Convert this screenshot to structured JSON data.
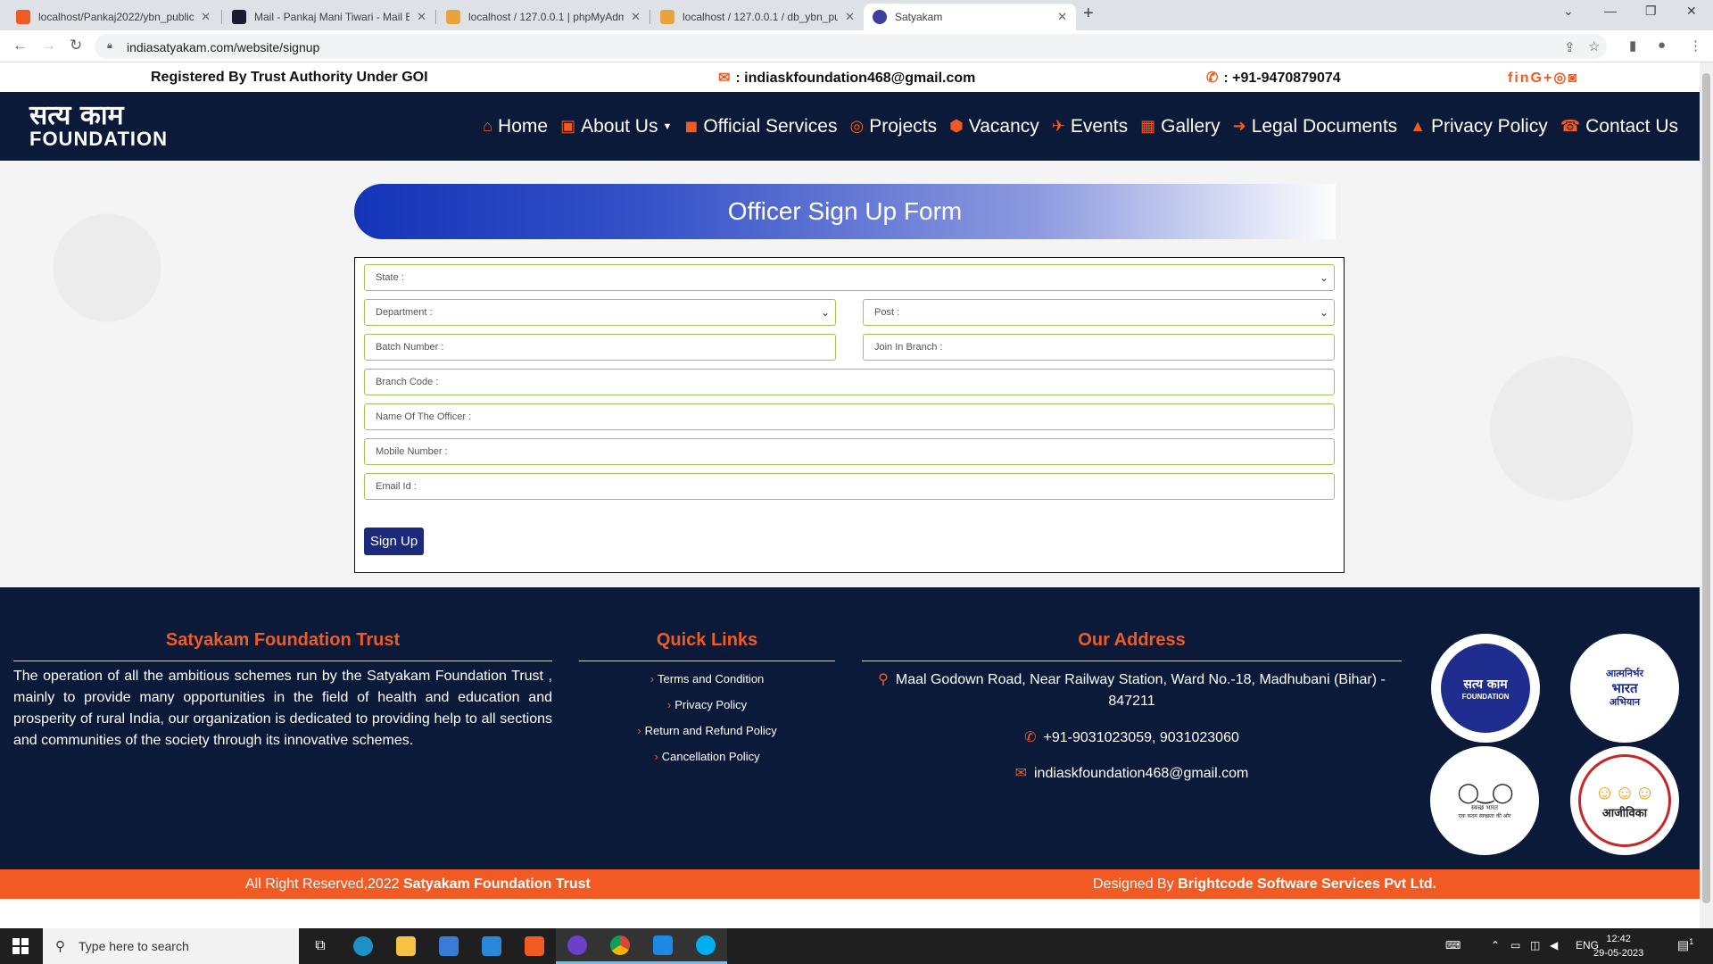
{
  "browser": {
    "tabs": [
      {
        "title": "localhost/Pankaj2022/ybn_public",
        "favicon_color": "#f15a22"
      },
      {
        "title": "Mail - Pankaj Mani Tiwari - Mail E",
        "favicon_color": "#1b1b2f"
      },
      {
        "title": "localhost / 127.0.0.1 | phpMyAdm",
        "favicon_color": "#e8a33d"
      },
      {
        "title": "localhost / 127.0.0.1 / db_ybn_pu",
        "favicon_color": "#e8a33d"
      },
      {
        "title": "Satyakam",
        "favicon_color": "#3b3f9e"
      }
    ],
    "url": "indiasatyakam.com/website/signup"
  },
  "topbar": {
    "registered": "Registered By Trust Authority Under GOI",
    "email": ": indiaskfoundation468@gmail.com",
    "phone": ": +91-9470879074"
  },
  "logo": {
    "hindi": "सत्य काम",
    "english": "FOUNDATION"
  },
  "nav": [
    {
      "label": "Home",
      "icon": "home-icon",
      "glyph": "⌂"
    },
    {
      "label": "About Us",
      "icon": "briefcase-icon",
      "glyph": "▣"
    },
    {
      "label": "Official Services",
      "icon": "suitcase-icon",
      "glyph": "◼"
    },
    {
      "label": "Projects",
      "icon": "lifebuoy-icon",
      "glyph": "◎"
    },
    {
      "label": "Vacancy",
      "icon": "cube-icon",
      "glyph": "⬢"
    },
    {
      "label": "Events",
      "icon": "plane-icon",
      "glyph": "✈"
    },
    {
      "label": "Gallery",
      "icon": "grid-icon",
      "glyph": "▦"
    },
    {
      "label": "Legal Documents",
      "icon": "arrow-icon",
      "glyph": "➜"
    },
    {
      "label": "Privacy Policy",
      "icon": "lock-icon",
      "glyph": "▲"
    },
    {
      "label": "Contact Us",
      "icon": "phone-icon",
      "glyph": "☎"
    }
  ],
  "form": {
    "title": "Officer Sign Up Form",
    "state": "State :",
    "department": "Department :",
    "post": "Post :",
    "batch": "Batch Number :",
    "join_branch": "Join In Branch :",
    "branch_code": "Branch Code :",
    "officer_name": "Name Of The Officer :",
    "mobile": "Mobile Number :",
    "email": "Email Id :",
    "submit": "Sign Up"
  },
  "footer": {
    "about_title": "Satyakam Foundation Trust",
    "about_text": "The operation of all the ambitious schemes run by the Satyakam Foundation Trust , mainly to provide many opportunities in the field of health and education and prosperity of rural India, our organization is dedicated to providing help to all sections and communities of the society through its innovative schemes.",
    "links_title": "Quick Links",
    "links": [
      "Terms and Condition",
      "Privacy Policy",
      "Return and Refund Policy",
      "Cancellation Policy"
    ],
    "address_title": "Our Address",
    "address": "Maal Godown Road, Near Railway Station, Ward No.-18, Madhubani (Bihar) - 847211",
    "phones": "+91-9031023059, 9031023060",
    "email": "indiaskfoundation468@gmail.com",
    "copyright_prefix": "All Right Reserved,2022",
    "copyright_name": "Satyakam Foundation Trust",
    "designed_prefix": "Designed By",
    "designed_name": "Brightcode Software Services Pvt Ltd."
  },
  "badges": {
    "satyakam": {
      "hindi": "सत्य काम",
      "english": "FOUNDATION"
    },
    "atmanirbhar": {
      "line1": "आत्मनिर्भर",
      "line2": "भारत",
      "line3": "अभियान"
    },
    "swachh": {
      "left": "स्वच्छ",
      "right": "भारत",
      "caption": "एक कदम स्वच्छता की ओर"
    },
    "aajeevika": {
      "label": "आजीविका"
    }
  },
  "taskbar": {
    "search_placeholder": "Type here to search",
    "lang": "ENG",
    "time": "12:42",
    "date": "29-05-2023",
    "notification_count": "1"
  }
}
